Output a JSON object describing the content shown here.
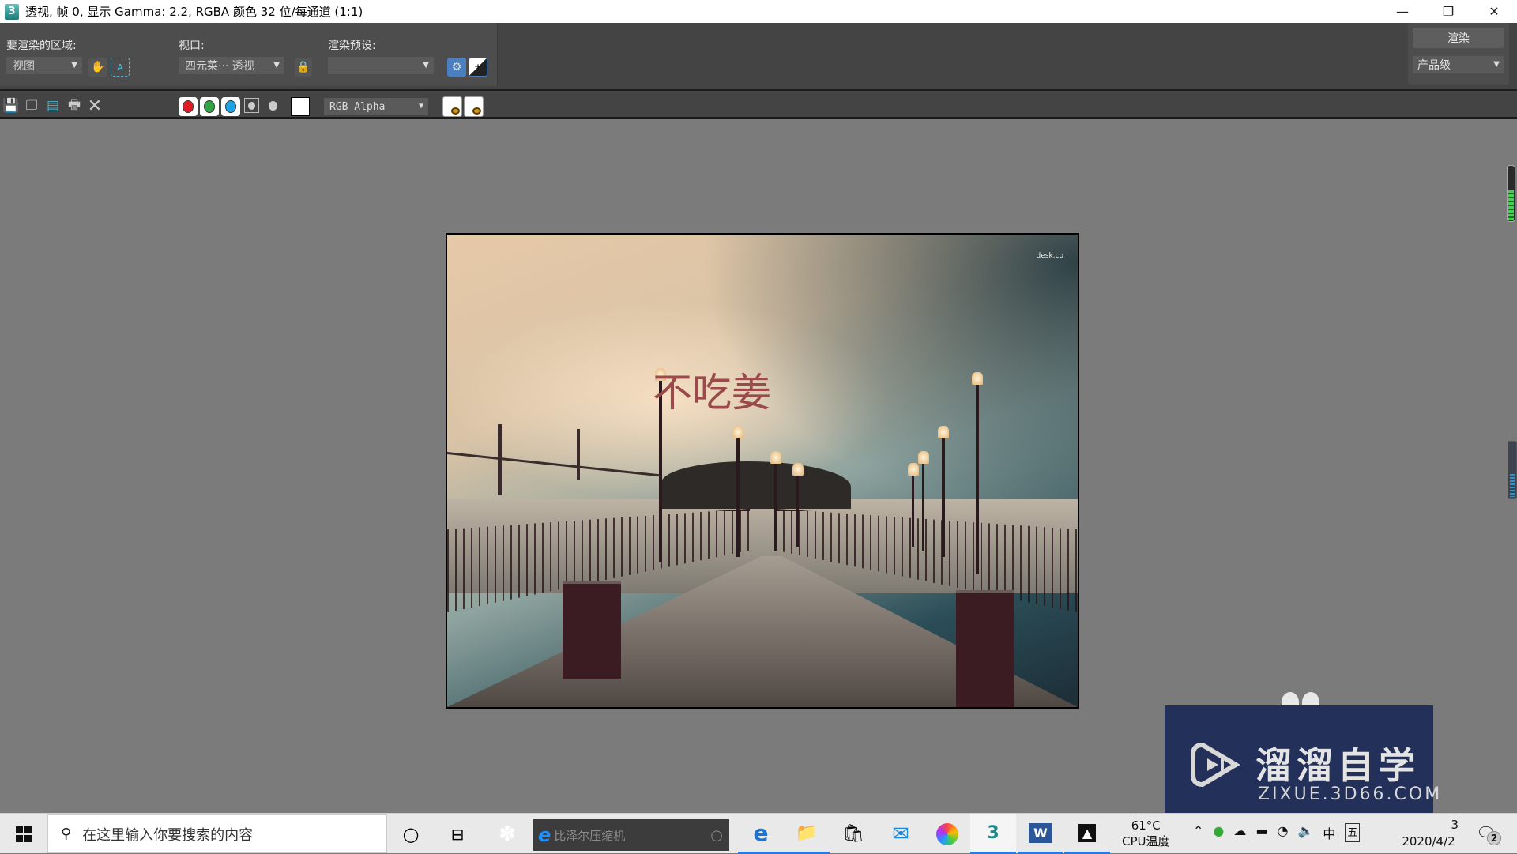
{
  "window": {
    "title": "透视, 帧 0, 显示 Gamma: 2.2, RGBA 颜色 32 位/每通道 (1:1)",
    "app_icon": "3dsmax-icon",
    "controls": {
      "minimize": "—",
      "restore": "❐",
      "close": "✕"
    }
  },
  "render_toolbar": {
    "area_label": "要渲染的区域:",
    "area_value": "视图",
    "viewport_label": "视口:",
    "viewport_value": "四元菜··· 透视",
    "preset_label": "渲染预设:",
    "preset_value": "",
    "render_button": "渲染",
    "quality_value": "产品级",
    "icons": [
      "pan-hand-icon",
      "auto-region-icon",
      "lock-icon",
      "render-setup-teapot-icon",
      "exposure-control-icon"
    ]
  },
  "frame_toolbar": {
    "icons": [
      "save-icon",
      "clone-icon",
      "copy-icon",
      "print-icon",
      "clear-icon"
    ],
    "channels": [
      {
        "name": "red",
        "color": "#e01b24"
      },
      {
        "name": "green",
        "color": "#33a245"
      },
      {
        "name": "blue",
        "color": "#1ea3e6"
      }
    ],
    "channel_display": "RGB Alpha",
    "swatch_color": "#ffffff"
  },
  "render_output": {
    "overlay_text": "不吃姜",
    "corner_mark": "desk.co",
    "description": "Pier at dusk with lamp posts and suspension bridge"
  },
  "meters": {
    "green_level": 0.55,
    "blue_level": 0.4
  },
  "watermark": {
    "brand_cn": "溜溜自学",
    "brand_url": "ZIXUE.3D66.COM"
  },
  "taskbar": {
    "search_placeholder": "在这里输入你要搜索的内容",
    "ie_search_placeholder": "比泽尔压缩机",
    "apps": [
      {
        "name": "edge",
        "glyph": "e",
        "active": true
      },
      {
        "name": "file-explorer",
        "glyph": "📁",
        "active": true
      },
      {
        "name": "store",
        "glyph": "🛍",
        "active": false
      },
      {
        "name": "mail",
        "glyph": "✉",
        "active": false
      },
      {
        "name": "photos-color",
        "glyph": "◉",
        "active": false
      },
      {
        "name": "3ds-max",
        "glyph": "3",
        "active": true
      },
      {
        "name": "word",
        "glyph": "W",
        "active": true
      },
      {
        "name": "photos",
        "glyph": "▲",
        "active": true
      }
    ],
    "cpu_temp": "61°C",
    "cpu_label": "CPU温度",
    "ime": "中",
    "ime2": "五",
    "time_partial": "3",
    "date": "2020/4/2",
    "notifications": "2"
  }
}
